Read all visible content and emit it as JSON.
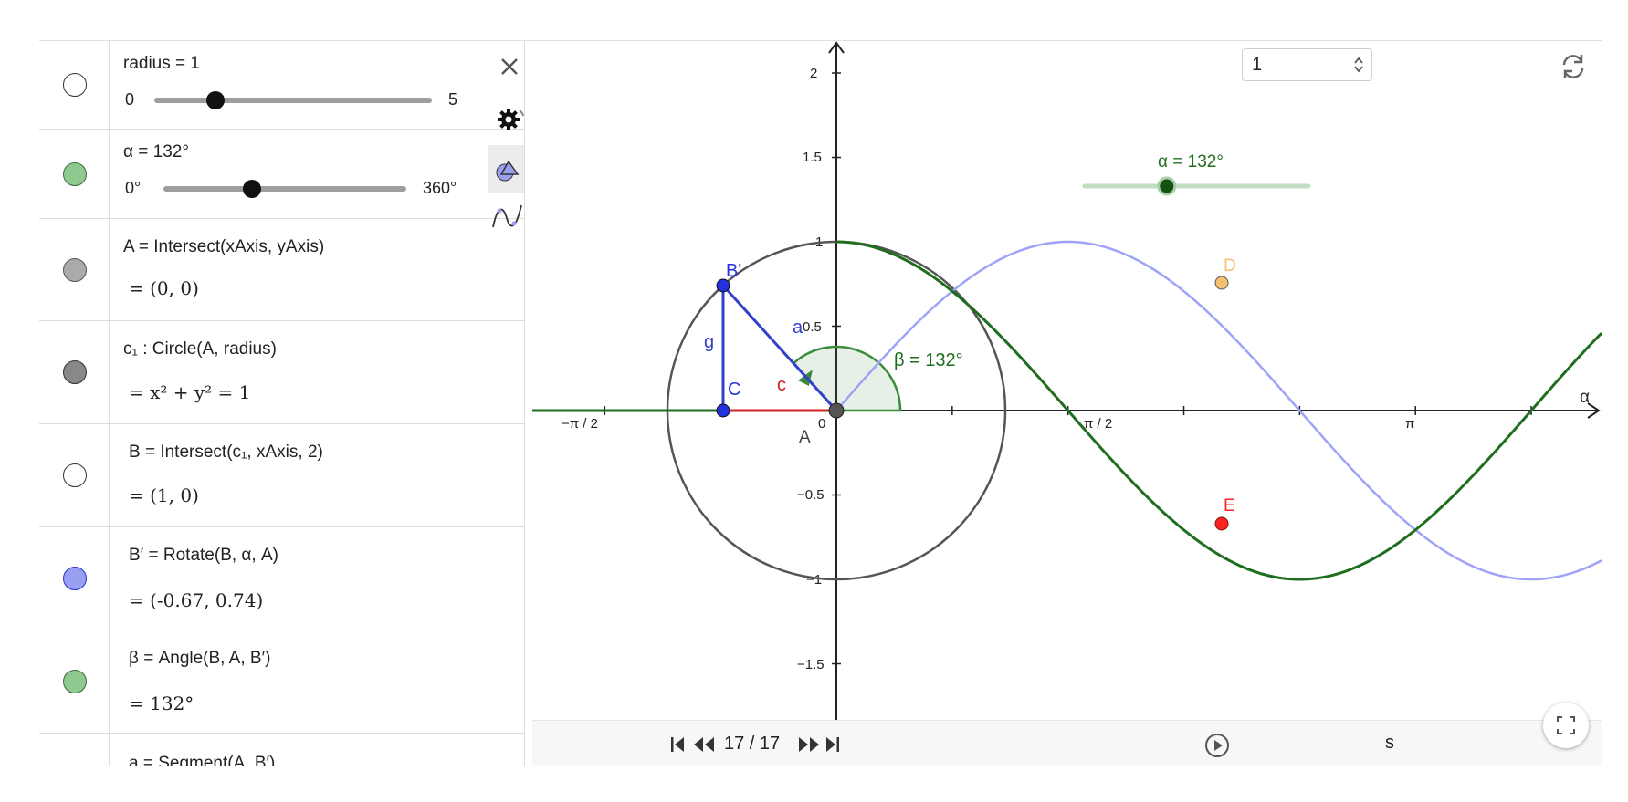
{
  "algebra": {
    "rows": [
      {
        "kind": "slider",
        "definition": "radius = 1",
        "min": "0",
        "max": "5",
        "fraction": 0.2,
        "marble": "#ffffff"
      },
      {
        "kind": "slider",
        "definition": "α = 132°",
        "min": "0°",
        "max": "360°",
        "fraction": 0.3667,
        "marble": "#8fc98f"
      },
      {
        "kind": "expr",
        "definition": "A = Intersect(xAxis, yAxis)",
        "value": "= (0, 0)",
        "marble": "#aaaaaa"
      },
      {
        "kind": "expr",
        "definition": "c₁ : Circle(A, radius)",
        "value": "= x² + y² = 1",
        "marble": "#888888"
      },
      {
        "kind": "expr",
        "definition": "B = Intersect(c₁, xAxis, 2)",
        "value": "= (1, 0)",
        "marble": "#ffffff"
      },
      {
        "kind": "expr",
        "definition": "B′ = Rotate(B, α, A)",
        "value": "= (-0.67, 0.74)",
        "marble": "#9aa0f0"
      },
      {
        "kind": "expr",
        "definition": "β = Angle(B, A, B′)",
        "value": "= 132°",
        "marble": "#8fc98f"
      },
      {
        "kind": "expr",
        "definition": "a = Segment(A, B′)",
        "value": "",
        "marble": "#ffffff"
      }
    ],
    "icons": [
      "close-icon",
      "gear-icon",
      "graphics-view-icon",
      "graph-icon"
    ]
  },
  "graphics": {
    "slider_label": "α = 132°",
    "slider_fraction": 0.3667,
    "axis_label_x": "α",
    "x_ticks": [
      "−π / 2",
      "0",
      "π / 2",
      "π"
    ],
    "y_ticks": [
      "2",
      "1.5",
      "1",
      "0.5",
      "−0.5",
      "−1",
      "−1.5"
    ],
    "points": {
      "B_prime": {
        "label": "B'",
        "color": "#2233dd"
      },
      "C": {
        "label": "C",
        "color": "#2233dd"
      },
      "A": {
        "label": "A",
        "color": "#444444"
      },
      "D": {
        "label": "D",
        "color": "#f5c070"
      },
      "E": {
        "label": "E",
        "color": "#ff2222"
      }
    },
    "segment_labels": {
      "a": "a",
      "g": "g",
      "c": "c"
    },
    "angle_label": "β = 132°",
    "colors": {
      "sine": "#9ea3f8",
      "cosine": "#1f6e1f",
      "angle": "#3a8c3a",
      "circle": "#555555",
      "segment_a": "#3340cc",
      "segment_g": "#3340cc",
      "segment_c": "#cc2222"
    },
    "icons": [
      "refresh-icon",
      "fullscreen-icon"
    ]
  },
  "playbar": {
    "counter": "17 / 17",
    "speed_value": "1",
    "speed_unit": "s",
    "icons": [
      "skip-start-icon",
      "step-back-icon",
      "step-forward-icon",
      "skip-end-icon",
      "play-icon"
    ]
  }
}
